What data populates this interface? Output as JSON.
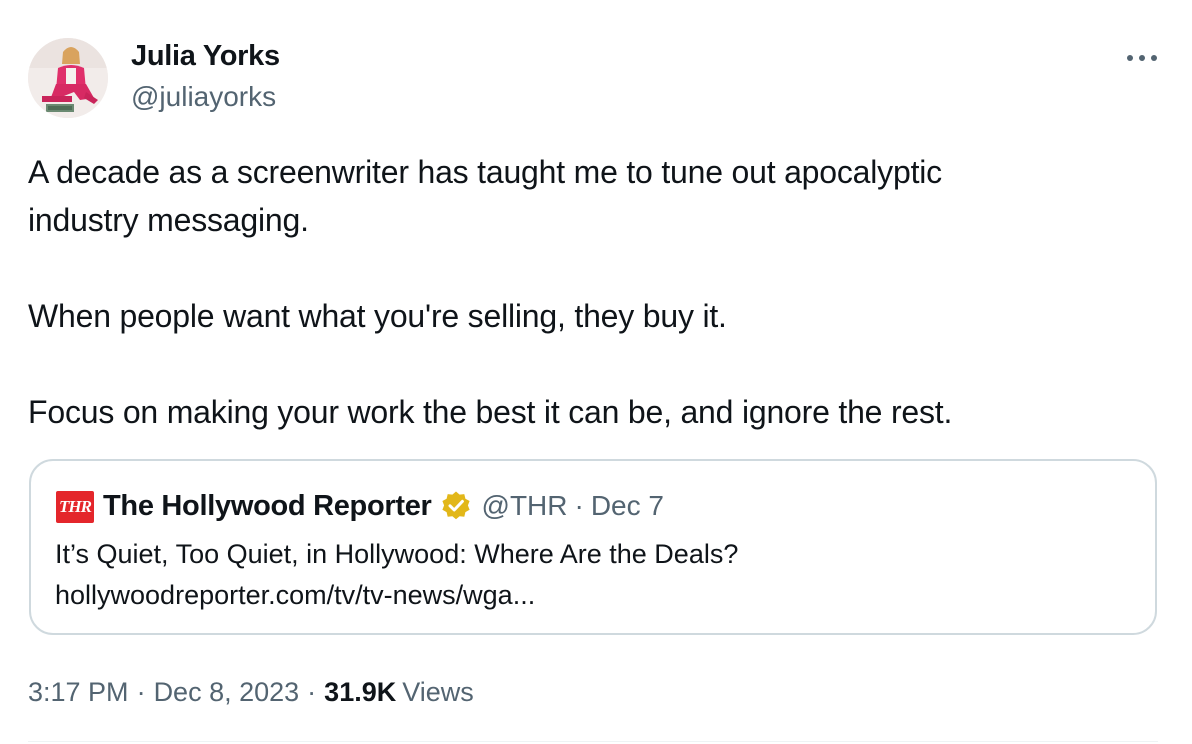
{
  "author": {
    "name": "Julia Yorks",
    "handle": "@juliayorks",
    "avatar_icon": "person-avatar-photo"
  },
  "more_icon": "more-horizontal-icon",
  "tweet": {
    "paragraphs": [
      "A decade as a screenwriter has taught me to tune out apocalyptic",
      "industry messaging.",
      "When people want what you're selling, they buy it.",
      "Focus on making your work the best it can be, and ignore the rest."
    ]
  },
  "quote": {
    "logo_text": "THR",
    "name": "The Hollywood Reporter",
    "verified_icon": "gold-verified-badge-icon",
    "handle": "@THR",
    "dot": "·",
    "date": "Dec 7",
    "title": "It’s Quiet, Too Quiet, in Hollywood: Where Are the Deals?",
    "link": "hollywoodreporter.com/tv/tv-news/wga..."
  },
  "meta": {
    "time": "3:17 PM",
    "sep": "·",
    "date": "Dec 8, 2023",
    "views_count": "31.9K",
    "views_label": "Views"
  },
  "colors": {
    "text": "#0f1419",
    "secondary": "#536471",
    "border": "#cfd9de",
    "thr_red": "#e4262b",
    "verified_gold": "#e2b719"
  }
}
